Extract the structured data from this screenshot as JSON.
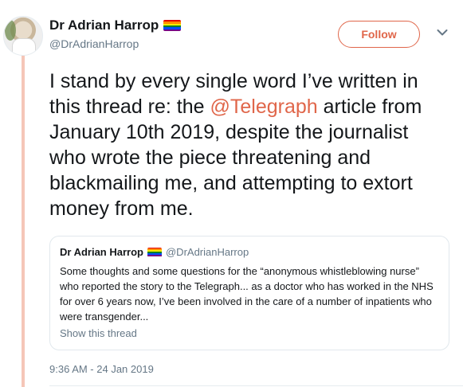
{
  "author": {
    "display_name": "Dr Adrian Harrop",
    "handle": "@DrAdrianHarrop",
    "badge_icon": "rainbow-flag-icon"
  },
  "follow_button": {
    "label": "Follow",
    "color": "#e0664a"
  },
  "menu_icon": "chevron-down-icon",
  "tweet": {
    "text_before": "I stand by every single word I’ve written in this thread re: the ",
    "mention": "@Telegraph",
    "text_after": " article from January 10th 2019, despite the journalist who wrote the piece threatening and blackmailing me, and attempting to extort money from me.",
    "timestamp": "9:36 AM - 24 Jan 2019"
  },
  "quoted_tweet": {
    "display_name": "Dr Adrian Harrop",
    "handle": "@DrAdrianHarrop",
    "text": "Some thoughts and some questions for the “anonymous whistleblowing nurse” who reported the story to the Telegraph... as a doctor who has worked in the NHS for over 6 years now, I’ve been involved in the care of a number of inpatients who were transgender...",
    "show_thread_label": "Show this thread"
  },
  "colors": {
    "accent": "#e0664a",
    "thread_line": "#f5c6b8",
    "secondary_text": "#657786",
    "border": "#e1e8ed"
  }
}
